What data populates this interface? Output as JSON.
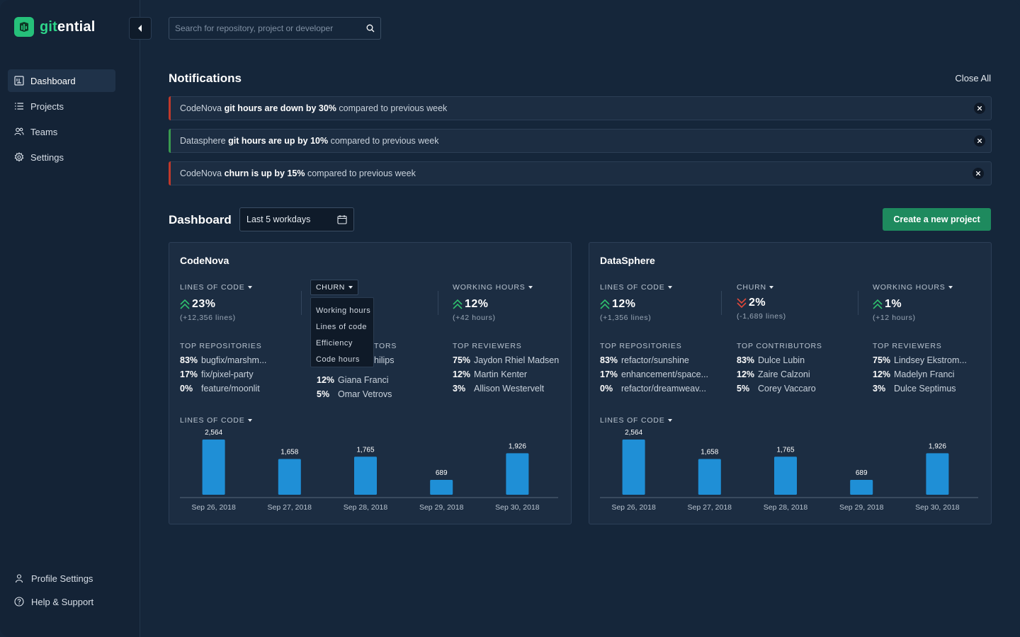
{
  "app": {
    "logo_part1": "git",
    "logo_part2": "ential"
  },
  "sidebar": {
    "items": [
      {
        "label": "Dashboard",
        "icon": "dashboard-icon"
      },
      {
        "label": "Projects",
        "icon": "list-icon"
      },
      {
        "label": "Teams",
        "icon": "users-icon"
      },
      {
        "label": "Settings",
        "icon": "gear-icon"
      }
    ],
    "bottom": [
      {
        "label": "Profile Settings",
        "icon": "user-icon"
      },
      {
        "label": "Help & Support",
        "icon": "help-icon"
      }
    ]
  },
  "search": {
    "placeholder": "Search for repository, project or developer"
  },
  "notifications": {
    "title": "Notifications",
    "close_all": "Close All",
    "items": [
      {
        "project": "CodeNova",
        "highlight": "git hours are down by 30%",
        "rest": "compared to previous week",
        "status_color": "#c0392b"
      },
      {
        "project": "Datasphere",
        "highlight": "git hours are up by 10%",
        "rest": "compared to previous week",
        "status_color": "#3a9a4f"
      },
      {
        "project": "CodeNova",
        "highlight": "churn is up by 15%",
        "rest": "compared to previous week",
        "status_color": "#c0392b"
      }
    ]
  },
  "dashboard": {
    "title": "Dashboard",
    "range": "Last 5 workdays",
    "create_button": "Create a new project"
  },
  "codenova": {
    "title": "CodeNova",
    "m1": {
      "label": "LINES OF CODE",
      "value": "23%",
      "sub": "(+12,356 lines)"
    },
    "m2": {
      "label": "CHURN"
    },
    "m3": {
      "label": "WORKING HOURS",
      "value": "12%",
      "sub": "(+42 hours)"
    },
    "menu": [
      "Working hours",
      "Lines of code",
      "Efficiency",
      "Code hours"
    ],
    "repos": {
      "title": "TOP REPOSITORIES",
      "rows": [
        [
          "83%",
          "bugfix/marshm..."
        ],
        [
          "17%",
          "fix/pixel-party"
        ],
        [
          "0%",
          "feature/moonlit"
        ]
      ]
    },
    "contrib": {
      "title_tail": "TORS",
      "row1_tail": "hilips",
      "rows": [
        [
          "12%",
          "Giana Franci"
        ],
        [
          "5%",
          "Omar Vetrovs"
        ]
      ]
    },
    "reviewers": {
      "title": "TOP REVIEWERS",
      "rows": [
        [
          "75%",
          "Jaydon Rhiel Madsen"
        ],
        [
          "12%",
          "Martin Kenter"
        ],
        [
          "3%",
          "Allison Westervelt"
        ]
      ]
    },
    "chart_label": "LINES OF CODE"
  },
  "datasphere": {
    "title": "DataSphere",
    "m1": {
      "label": "LINES OF CODE",
      "value": "12%",
      "sub": "(+1,356 lines)"
    },
    "m2": {
      "label": "CHURN",
      "value": "2%",
      "sub": "(-1,689 lines)"
    },
    "m3": {
      "label": "WORKING HOURS",
      "value": "1%",
      "sub": "(+12 hours)"
    },
    "repos": {
      "title": "TOP REPOSITORIES",
      "rows": [
        [
          "83%",
          "refactor/sunshine"
        ],
        [
          "17%",
          "enhancement/space..."
        ],
        [
          "0%",
          "refactor/dreamweav..."
        ]
      ]
    },
    "contrib": {
      "title": "TOP CONTRIBUTORS",
      "rows": [
        [
          "83%",
          "Dulce Lubin"
        ],
        [
          "12%",
          "Zaire Calzoni"
        ],
        [
          "5%",
          "Corey Vaccaro"
        ]
      ]
    },
    "reviewers": {
      "title": "TOP REVIEWERS",
      "rows": [
        [
          "75%",
          "Lindsey Ekstrom..."
        ],
        [
          "12%",
          "Madelyn Franci"
        ],
        [
          "3%",
          "Dulce Septimus"
        ]
      ]
    },
    "chart_label": "LINES OF CODE"
  },
  "colors": {
    "up": "#2fbf6e",
    "down": "#e0483a",
    "bar": "#1f8fd6",
    "accent": "#1e8a5e"
  },
  "chart_data": [
    {
      "type": "bar",
      "categories": [
        "Sep 26, 2018",
        "Sep 27, 2018",
        "Sep 28, 2018",
        "Sep 29, 2018",
        "Sep 30, 2018"
      ],
      "values": [
        2564,
        1658,
        1765,
        689,
        1926
      ],
      "labels": [
        "2,564",
        "1,658",
        "1,765",
        "689",
        "1,926"
      ],
      "title": "LINES OF CODE",
      "grid": false
    },
    {
      "type": "bar",
      "categories": [
        "Sep 26, 2018",
        "Sep 27, 2018",
        "Sep 28, 2018",
        "Sep 29, 2018",
        "Sep 30, 2018"
      ],
      "values": [
        2564,
        1658,
        1765,
        689,
        1926
      ],
      "labels": [
        "2,564",
        "1,658",
        "1,765",
        "689",
        "1,926"
      ],
      "title": "LINES OF CODE",
      "grid": false
    }
  ]
}
